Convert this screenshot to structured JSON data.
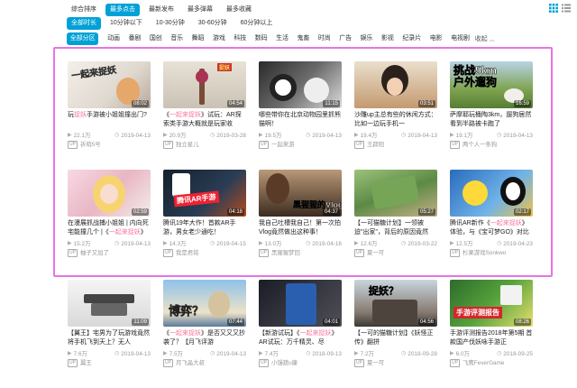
{
  "sort_tabs": [
    {
      "label": "综合排序",
      "active": false
    },
    {
      "label": "最多点击",
      "active": true
    },
    {
      "label": "最新发布",
      "active": false
    },
    {
      "label": "最多弹幕",
      "active": false
    },
    {
      "label": "最多收藏",
      "active": false
    }
  ],
  "duration_filters": [
    {
      "label": "全部时长",
      "active": true
    },
    {
      "label": "10分钟以下",
      "active": false
    },
    {
      "label": "10-30分钟",
      "active": false
    },
    {
      "label": "30-60分钟",
      "active": false
    },
    {
      "label": "60分钟以上",
      "active": false
    }
  ],
  "category_filters": [
    {
      "label": "全部分区",
      "active": true
    },
    {
      "label": "动画",
      "active": false
    },
    {
      "label": "番剧",
      "active": false
    },
    {
      "label": "国创",
      "active": false
    },
    {
      "label": "音乐",
      "active": false
    },
    {
      "label": "舞蹈",
      "active": false
    },
    {
      "label": "游戏",
      "active": false
    },
    {
      "label": "科技",
      "active": false
    },
    {
      "label": "数码",
      "active": false
    },
    {
      "label": "生活",
      "active": false
    },
    {
      "label": "鬼畜",
      "active": false
    },
    {
      "label": "时尚",
      "active": false
    },
    {
      "label": "广告",
      "active": false
    },
    {
      "label": "娱乐",
      "active": false
    },
    {
      "label": "影视",
      "active": false
    },
    {
      "label": "纪录片",
      "active": false
    },
    {
      "label": "电影",
      "active": false
    },
    {
      "label": "电视剧",
      "active": false
    }
  ],
  "collapse_label": "收起",
  "icons": {
    "grid_view": "grid-view-icon",
    "list_view": "list-view-icon",
    "play": "play-icon",
    "date": "clock-icon",
    "uploader": "up-badge-icon"
  },
  "accent_color": "#00a1d6",
  "highlight_color": "#fb7299",
  "up_badge": "UP",
  "videos": [
    {
      "duration": "08:02",
      "overlay": "一起来捉妖",
      "title_pre": "玩",
      "title_hl": "捉妖",
      "title_post": "手游被小姐姐撞出门?",
      "views": "22.1万",
      "date": "2019-04-13",
      "uploader": "祈萌5号"
    },
    {
      "duration": "04:54",
      "overlay": "捉妖",
      "title_pre": "《",
      "title_hl": "一起来捉妖",
      "title_post": "》试玩：AR探索类手游大概就是玩家收",
      "views": "20.9万",
      "date": "2019-03-28",
      "uploader": "独立星儿"
    },
    {
      "duration": "11:15",
      "overlay": "",
      "title_pre": "哪些带你在北京动物园里抓",
      "title_hl": "",
      "title_post": "熊猫啊！",
      "views": "19.5万",
      "date": "2019-04-13",
      "uploader": "一起来游"
    },
    {
      "duration": "03:51",
      "overlay": "",
      "title_pre": "沙雕up主总有些的休闲方式：比如一边玩手机一",
      "title_hl": "",
      "title_post": "",
      "views": "19.4万",
      "date": "2019-04-13",
      "uploader": "王辟阳"
    },
    {
      "duration": "16:59",
      "overlay": "挑战5km户外遛狗",
      "title_pre": "萨摩耶玩桶陶3km，遛狗居然",
      "title_hl": "",
      "title_post": "看到半路被卡跑了",
      "views": "19.1万",
      "date": "2019-04-13",
      "uploader": "两个人一条狗"
    },
    {
      "duration": "02:59",
      "overlay": "",
      "title_pre": "在漫展抓战捕小姐姐 | 内向死宅能撞几个 |《",
      "title_hl": "一起来捉妖",
      "title_post": "》",
      "views": "15.2万",
      "date": "2019-04-13",
      "uploader": "柚子又加了"
    },
    {
      "duration": "04:18",
      "overlay": "腾讯AR手游",
      "title_pre": "腾讯19年大作！首款AR手",
      "title_hl": "",
      "title_post": "游，男女老少通吃！",
      "views": "14.3万",
      "date": "2019-04-15",
      "uploader": "我是君铭"
    },
    {
      "duration": "04:37",
      "overlay": "黑猩猩的Vlog",
      "title_pre": "我自己吐槽我自己！第一次拍Vlog竟然做出这种事！",
      "title_hl": "",
      "title_post": "",
      "views": "13.0万",
      "date": "2019-04-16",
      "uploader": "黑猩猩梦回"
    },
    {
      "duration": "05:27",
      "overlay": "",
      "title_pre": "【一可猫糖计划】一领被迫\"出家\"，背后的原因竟然",
      "title_hl": "",
      "title_post": "",
      "views": "12.6万",
      "date": "2019-03-22",
      "uploader": "夏一可"
    },
    {
      "duration": "02:17",
      "overlay": "",
      "title_pre": "腾讯AR新作《",
      "title_hl": "一起来捉妖",
      "title_post": "》体验，与《宝可梦GO》对比",
      "views": "12.5万",
      "date": "2019-04-23",
      "uploader": "杉果游戏Sonkwo"
    },
    {
      "duration": "11:09",
      "overlay": "",
      "title_pre": "【翼王】宅男为了玩游戏竟然将手机飞到天上？无人",
      "title_hl": "",
      "title_post": "",
      "views": "7.6万",
      "date": "2019-04-13",
      "uploader": "翼王"
    },
    {
      "duration": "07:44",
      "overlay": "博弈？",
      "title_pre": "《",
      "title_hl": "一起来捉妖",
      "title_post": "》是否又又又抄袭了？【月飞评游",
      "views": "7.5万",
      "date": "2019-04-13",
      "uploader": "月飞晶大叔"
    },
    {
      "duration": "04:01",
      "overlay": "",
      "title_pre": "【新游试玩】《",
      "title_hl": "一起来捉妖",
      "title_post": "》AR试玩：万千精灵、尽",
      "views": "7.4万",
      "date": "2018-09-13",
      "uploader": "小馒蔬u康"
    },
    {
      "duration": "04:56",
      "overlay": "捉妖？",
      "title_pre": "【一可的猫糖计划】《妖怪正传》翻拼",
      "title_hl": "",
      "title_post": "",
      "views": "7.2万",
      "date": "2018-09-28",
      "uploader": "夏一可"
    },
    {
      "duration": "08:26",
      "overlay": "手游评测报告",
      "title_pre": "手游评测报告2018年第5期 首款国产伐妖咏手游正",
      "title_hl": "",
      "title_post": "",
      "views": "6.0万",
      "date": "2018-09-25",
      "uploader": "飞鹰FeverGame"
    }
  ]
}
